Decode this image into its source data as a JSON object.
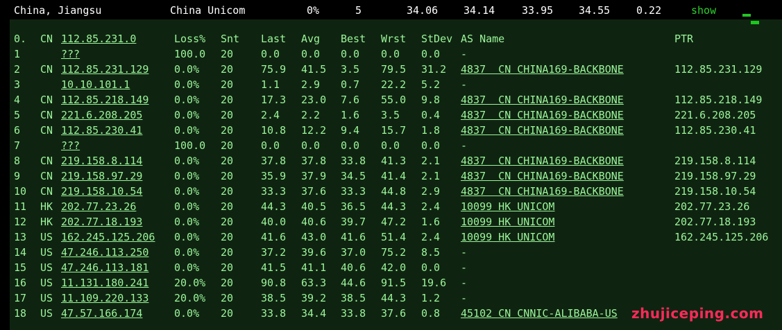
{
  "summary": {
    "location": "China, Jiangsu",
    "isp": "China Unicom",
    "loss": "0%",
    "sent": "5",
    "last": "34.06",
    "avg": "34.14",
    "best": "33.95",
    "wrst": "34.55",
    "stdev": "0.22",
    "show_label": "show"
  },
  "columns": {
    "hop": "0.",
    "cc": "CN",
    "host": "112.85.231.0",
    "loss": "Loss%",
    "snt": "Snt",
    "last": "Last",
    "avg": "Avg",
    "best": "Best",
    "wrst": "Wrst",
    "stdev": "StDev",
    "as": "AS Name",
    "ptr": "PTR"
  },
  "hops": [
    {
      "hop": "1",
      "cc": "",
      "host": "???",
      "loss": "100.0",
      "snt": "20",
      "last": "0.0",
      "avg": "0.0",
      "best": "0.0",
      "wrst": "0.0",
      "stdev": "0.0",
      "as": "-",
      "ptr": ""
    },
    {
      "hop": "2",
      "cc": "CN",
      "host": "112.85.231.129",
      "loss": "0.0%",
      "snt": "20",
      "last": "75.9",
      "avg": "41.5",
      "best": "3.5",
      "wrst": "79.5",
      "stdev": "31.2",
      "as": "4837  CN CHINA169-BACKBONE",
      "ptr": "112.85.231.129"
    },
    {
      "hop": "3",
      "cc": "",
      "host": "10.10.101.1",
      "loss": "0.0%",
      "snt": "20",
      "last": "1.1",
      "avg": "2.9",
      "best": "0.7",
      "wrst": "22.2",
      "stdev": "5.2",
      "as": "-",
      "ptr": ""
    },
    {
      "hop": "4",
      "cc": "CN",
      "host": "112.85.218.149",
      "loss": "0.0%",
      "snt": "20",
      "last": "17.3",
      "avg": "23.0",
      "best": "7.6",
      "wrst": "55.0",
      "stdev": "9.8",
      "as": "4837  CN CHINA169-BACKBONE",
      "ptr": "112.85.218.149"
    },
    {
      "hop": "5",
      "cc": "CN",
      "host": "221.6.208.205",
      "loss": "0.0%",
      "snt": "20",
      "last": "2.4",
      "avg": "2.2",
      "best": "1.6",
      "wrst": "3.5",
      "stdev": "0.4",
      "as": "4837  CN CHINA169-BACKBONE",
      "ptr": "221.6.208.205"
    },
    {
      "hop": "6",
      "cc": "CN",
      "host": "112.85.230.41",
      "loss": "0.0%",
      "snt": "20",
      "last": "10.8",
      "avg": "12.2",
      "best": "9.4",
      "wrst": "15.7",
      "stdev": "1.8",
      "as": "4837  CN CHINA169-BACKBONE",
      "ptr": "112.85.230.41"
    },
    {
      "hop": "7",
      "cc": "",
      "host": "???",
      "loss": "100.0",
      "snt": "20",
      "last": "0.0",
      "avg": "0.0",
      "best": "0.0",
      "wrst": "0.0",
      "stdev": "0.0",
      "as": "-",
      "ptr": ""
    },
    {
      "hop": "8",
      "cc": "CN",
      "host": "219.158.8.114",
      "loss": "0.0%",
      "snt": "20",
      "last": "37.8",
      "avg": "37.8",
      "best": "33.8",
      "wrst": "41.3",
      "stdev": "2.1",
      "as": "4837  CN CHINA169-BACKBONE",
      "ptr": "219.158.8.114"
    },
    {
      "hop": "9",
      "cc": "CN",
      "host": "219.158.97.29",
      "loss": "0.0%",
      "snt": "20",
      "last": "35.9",
      "avg": "37.9",
      "best": "34.5",
      "wrst": "41.4",
      "stdev": "2.1",
      "as": "4837  CN CHINA169-BACKBONE",
      "ptr": "219.158.97.29"
    },
    {
      "hop": "10",
      "cc": "CN",
      "host": "219.158.10.54",
      "loss": "0.0%",
      "snt": "20",
      "last": "33.3",
      "avg": "37.6",
      "best": "33.3",
      "wrst": "44.8",
      "stdev": "2.9",
      "as": "4837  CN CHINA169-BACKBONE",
      "ptr": "219.158.10.54"
    },
    {
      "hop": "11",
      "cc": "HK",
      "host": "202.77.23.26",
      "loss": "0.0%",
      "snt": "20",
      "last": "44.3",
      "avg": "40.5",
      "best": "36.5",
      "wrst": "44.3",
      "stdev": "2.4",
      "as": "10099 HK UNICOM",
      "ptr": "202.77.23.26"
    },
    {
      "hop": "12",
      "cc": "HK",
      "host": "202.77.18.193",
      "loss": "0.0%",
      "snt": "20",
      "last": "40.0",
      "avg": "40.6",
      "best": "39.7",
      "wrst": "47.2",
      "stdev": "1.6",
      "as": "10099 HK UNICOM",
      "ptr": "202.77.18.193"
    },
    {
      "hop": "13",
      "cc": "US",
      "host": "162.245.125.206",
      "loss": "0.0%",
      "snt": "20",
      "last": "41.6",
      "avg": "43.0",
      "best": "41.6",
      "wrst": "51.4",
      "stdev": "2.4",
      "as": "10099 HK UNICOM",
      "ptr": "162.245.125.206"
    },
    {
      "hop": "14",
      "cc": "US",
      "host": "47.246.113.250",
      "loss": "0.0%",
      "snt": "20",
      "last": "37.2",
      "avg": "39.6",
      "best": "37.0",
      "wrst": "75.2",
      "stdev": "8.5",
      "as": "-",
      "ptr": ""
    },
    {
      "hop": "15",
      "cc": "US",
      "host": "47.246.113.181",
      "loss": "0.0%",
      "snt": "20",
      "last": "41.5",
      "avg": "41.1",
      "best": "40.6",
      "wrst": "42.0",
      "stdev": "0.0",
      "as": "-",
      "ptr": ""
    },
    {
      "hop": "16",
      "cc": "US",
      "host": "11.131.180.241",
      "loss": "20.0%",
      "snt": "20",
      "last": "90.8",
      "avg": "63.3",
      "best": "44.6",
      "wrst": "91.5",
      "stdev": "19.6",
      "as": "-",
      "ptr": ""
    },
    {
      "hop": "17",
      "cc": "US",
      "host": "11.109.220.133",
      "loss": "20.0%",
      "snt": "20",
      "last": "38.5",
      "avg": "39.2",
      "best": "38.5",
      "wrst": "44.3",
      "stdev": "1.2",
      "as": "-",
      "ptr": ""
    },
    {
      "hop": "18",
      "cc": "US",
      "host": "47.57.166.174",
      "loss": "0.0%",
      "snt": "20",
      "last": "33.8",
      "avg": "34.4",
      "best": "33.8",
      "wrst": "37.6",
      "stdev": "0.8",
      "as": "45102 CN CNNIC-ALIBABA-US",
      "ptr": ""
    }
  ],
  "watermark": "zhujiceping.com"
}
